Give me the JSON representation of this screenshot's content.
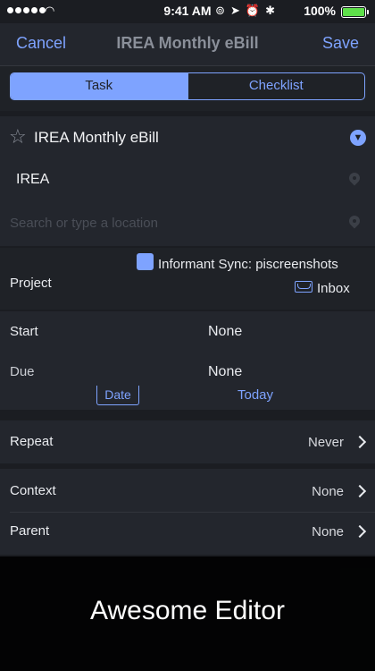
{
  "status": {
    "time": "9:41 AM",
    "battery": "100%"
  },
  "nav": {
    "cancel": "Cancel",
    "title": "IREA Monthly eBill",
    "save": "Save"
  },
  "tabs": [
    {
      "label": "Task",
      "active": true
    },
    {
      "label": "Checklist",
      "active": false
    }
  ],
  "task": {
    "title": "IREA Monthly eBill",
    "location_name": "IREA",
    "location_placeholder": "Search or type a location"
  },
  "project": {
    "label": "Project",
    "account": "Informant Sync: piscreenshots",
    "folder": "Inbox"
  },
  "dates": {
    "start_label": "Start",
    "start_value": "None",
    "due_label": "Due",
    "due_value": "None",
    "date_button": "Date",
    "today_button": "Today"
  },
  "rows": {
    "repeat_label": "Repeat",
    "repeat_value": "Never",
    "context_label": "Context",
    "context_value": "None",
    "parent_label": "Parent",
    "parent_value": "None"
  },
  "caption": "Awesome Editor",
  "colors": {
    "accent": "#7ea3ff",
    "battery": "#5ee04a"
  }
}
